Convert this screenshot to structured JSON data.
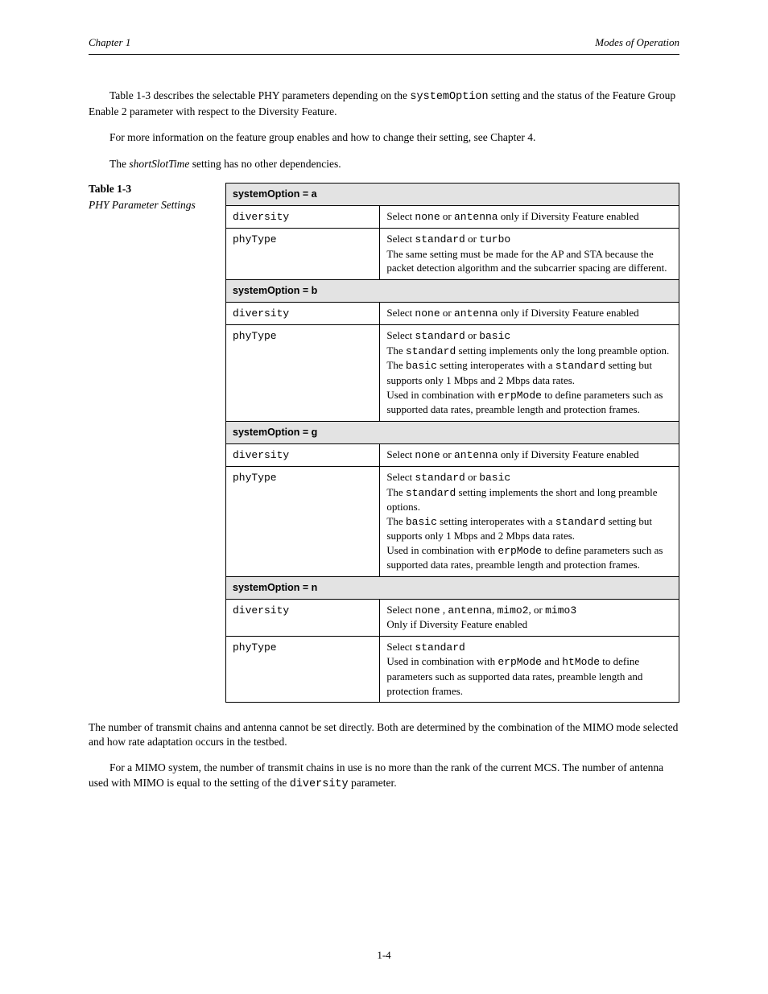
{
  "header": {
    "left": "Chapter 1",
    "right": "Modes of Operation"
  },
  "intro": {
    "p1_pre": "Table 1-3 describes the selectable PHY parameters depending on the ",
    "p1_code": "systemOption",
    "p1_post": " setting and the status of the Feature Group Enable 2 parameter with respect to the Diversity Feature.",
    "p2": "For more information on the feature group enables and how to change their setting, see Chapter 4.",
    "p3_pre": "The ",
    "p3_em": "shortSlotTime",
    "p3_post": " setting has no other dependencies."
  },
  "table": {
    "number": "Table 1-3",
    "title": "PHY Parameter Settings",
    "groups": [
      {
        "header": "systemOption = a",
        "rows": [
          {
            "c1": "diversity",
            "c2_pre": "Select ",
            "c2_code": "none",
            "c2_mid": "or ",
            "c2_code2": "antenna",
            "c2_post": "only if Diversity Feature enabled"
          },
          {
            "c1": "phyType",
            "c2_pre": "Select ",
            "c2_code": "standard",
            "c2_mid": "or ",
            "c2_code2": "turbo",
            "c2_post": "",
            "extra_line": "The same setting must be made for the AP and STA because the packet detection algorithm and the subcarrier spacing are different."
          }
        ]
      },
      {
        "header": "systemOption = b",
        "rows": [
          {
            "c1": "diversity",
            "c2_pre": "Select ",
            "c2_code": "none",
            "c2_mid": "or ",
            "c2_code2": "antenna",
            "c2_post": "only if Diversity Feature enabled"
          },
          {
            "c1": "phyType",
            "c2_pre": "Select ",
            "c2_code": "standard",
            "c2_mid": "or ",
            "c2_code2": "basic",
            "c2_post": "",
            "extra": [
              {
                "text_pre": "The ",
                "code": "standard",
                "text_mid": " setting implements only the long preamble option."
              },
              {
                "text_pre": "The ",
                "code": "basic",
                "text_mid": " setting interoperates with a ",
                "code2": "standard",
                "text_post": " setting but supports only 1 Mbps and 2 Mbps data rates."
              },
              {
                "text_pre": "Used in combination with ",
                "code": "erpMode",
                "text_mid": " to define parameters such as supported data rates, preamble length and protection frames."
              }
            ]
          }
        ]
      },
      {
        "header": "systemOption = g",
        "rows": [
          {
            "c1": "diversity",
            "c2_pre": "Select ",
            "c2_code": "none",
            "c2_mid": "or ",
            "c2_code2": "antenna",
            "c2_post": "only if Diversity Feature enabled"
          },
          {
            "c1": "phyType",
            "c2_pre": "Select ",
            "c2_code": "standard",
            "c2_mid": "or ",
            "c2_code2": "basic",
            "c2_post": "",
            "extra": [
              {
                "text_pre": "The ",
                "code": "standard",
                "text_mid": " setting implements the short and long preamble options."
              },
              {
                "text_pre": "The ",
                "code": "basic",
                "text_mid": " setting interoperates with a ",
                "code2": "standard",
                "text_post": " setting but supports only 1 Mbps and 2 Mbps data rates."
              },
              {
                "text_pre": "Used in combination with ",
                "code": "erpMode",
                "text_mid": " to define parameters such as supported data rates, preamble length and protection frames."
              }
            ]
          }
        ]
      },
      {
        "header": "systemOption = n",
        "rows": [
          {
            "c1": "diversity",
            "c2_pre": "Select ",
            "c2_code": "none",
            "c2_mid": ", ",
            "c2_code2": "antenna",
            "c2_mid2": ", ",
            "c2_code3": "mimo2",
            "c2_mid3": ", or ",
            "c2_code4": "mimo3",
            "c2_post": "",
            "extra_line": "Only if Diversity Feature enabled"
          },
          {
            "c1": "phyType",
            "c2_pre": "Select ",
            "c2_code": "standard",
            "c2_post": "",
            "extra_line_pre": "Used in combination with ",
            "extra_line_code": "erpMode",
            "extra_line_mid": " and ",
            "extra_line_code2": "htMode",
            "extra_line_post": "to define parameters such as supported data rates, preamble length and protection frames."
          }
        ]
      }
    ]
  },
  "after": {
    "p1": "The number of transmit chains and antenna cannot be set directly. Both are determined by the combination of the MIMO mode selected and how rate adaptation occurs in the testbed.",
    "p2_pre": "For a MIMO system, the number of transmit chains in use is no more than the rank of the current MCS. The number of antenna used with MIMO is equal to the setting of the ",
    "p2_code": "diversity",
    "p2_post": " parameter."
  },
  "footer": {
    "text": "1-4"
  }
}
